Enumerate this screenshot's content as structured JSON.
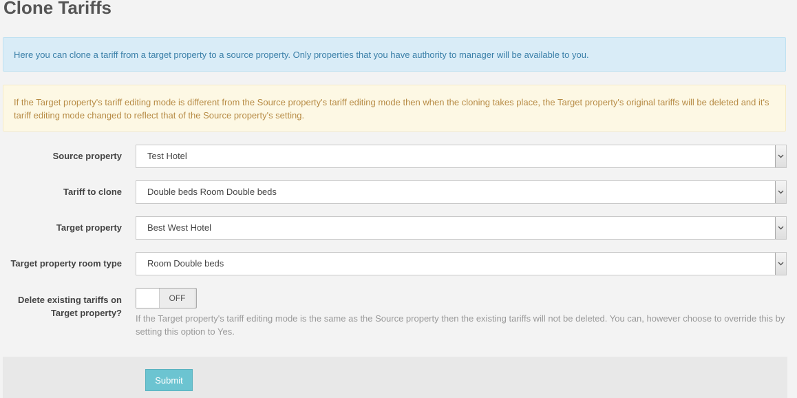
{
  "page": {
    "title": "Clone Tariffs"
  },
  "alerts": {
    "info": "Here you can clone a tariff from a target property to a source property. Only properties that you have authority to manager will be available to you.",
    "warning": "If the Target property's tariff editing mode is different from the Source property's tariff editing mode then when the cloning takes place, the Target property's original tariffs will be deleted and it's tariff editing mode changed to reflect that of the Source property's setting."
  },
  "form": {
    "fields": [
      {
        "label": "Source property",
        "value": "Test Hotel"
      },
      {
        "label": "Tariff to clone",
        "value": "Double beds Room Double beds"
      },
      {
        "label": "Target property",
        "value": "Best West Hotel"
      },
      {
        "label": "Target property room type",
        "value": "Room Double beds"
      }
    ],
    "delete_existing": {
      "label_line1": "Delete existing tariffs on",
      "label_line2": "Target property?",
      "state": "OFF",
      "help": "If the Target property's tariff editing mode is the same as the Source property then the existing tariffs will not be deleted. You can, however choose to override this by setting this option to Yes."
    },
    "submit_label": "Submit"
  },
  "icons": {
    "select_arrow": "chevron-down-icon"
  },
  "colors": {
    "info_bg": "#d9ecf7",
    "info_text": "#3a7fa8",
    "warning_bg": "#fdf8e4",
    "warning_text": "#b78b45",
    "submit_bg": "#6cc4d1"
  }
}
